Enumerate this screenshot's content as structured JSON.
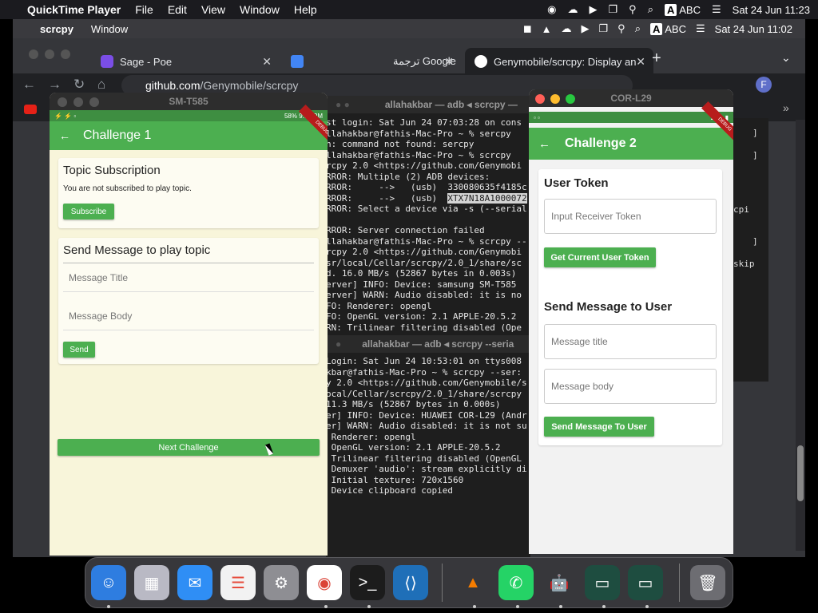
{
  "menubar": {
    "app": "QuickTime Player",
    "items": [
      "File",
      "Edit",
      "View",
      "Window",
      "Help"
    ],
    "input_source": "ABC",
    "datetime": "Sat 24 Jun  11:23"
  },
  "scrcpy_menubar": {
    "app": "scrcpy",
    "items": [
      "Window"
    ],
    "input_source": "ABC",
    "datetime": "Sat 24 Jun  11:02"
  },
  "browser": {
    "tabs": [
      {
        "label": "Sage - Poe"
      },
      {
        "label": "ترجمة Google"
      },
      {
        "label": "Genymobile/scrcpy: Display an"
      }
    ],
    "url_host": "github.com",
    "url_path": "/Genymobile/scrcpy",
    "profile_initial": "F"
  },
  "devices": {
    "left": {
      "window_title": "SM-T585",
      "status_right": "58% 9:02 PM",
      "debug_banner": "DEBUG",
      "app_title": "Challenge 1",
      "topic_card": {
        "title": "Topic Subscription",
        "text": "You are not subscribed to play topic.",
        "button": "Subscribe"
      },
      "send_card": {
        "title": "Send Message to play topic",
        "title_placeholder": "Message Title",
        "body_placeholder": "Message Body",
        "button": "Send"
      },
      "next_button": "Next Challenge"
    },
    "right": {
      "window_title": "COR-L29",
      "debug_banner": "DEBUG",
      "app_title": "Challenge 2",
      "token_title": "User Token",
      "token_placeholder": "Input Receiver Token",
      "token_button": "Get Current User Token",
      "send_title": "Send Message to User",
      "title_placeholder": "Message title",
      "body_placeholder": "Message body",
      "send_button": "Send Message To User"
    }
  },
  "terminal": {
    "window1_title": "allahakbar — adb ◂ scrcpy —",
    "window1_lines": [
      "st login: Sat Jun 24 07:03:28 on cons",
      "llahakbar@fathis-Mac-Pro ~ % sercpy",
      "h: command not found: sercpy",
      "llahakbar@fathis-Mac-Pro ~ % scrcpy",
      "rcpy 2.0 <https://github.com/Genymobi",
      "RROR: Multiple (2) ADB devices:",
      "RROR:     -->   (usb)  330080635f4185c",
      "RROR:     -->   (usb)  XTX7N18A1000072",
      "RROR: Select a device via -s (--serial",
      "",
      "RROR: Server connection failed",
      "llahakbar@fathis-Mac-Pro ~ % scrcpy --",
      "rcpy 2.0 <https://github.com/Genymobi",
      "sr/local/Cellar/scrcpy/2.0_1/share/sc",
      "d. 16.0 MB/s (52867 bytes in 0.003s)",
      "erver] INFO: Device: samsung SM-T585",
      "erver] WARN: Audio disabled: it is no",
      "FO: Renderer: opengl",
      "FO: OpenGL version: 2.1 APPLE-20.5.2",
      "RN: Trilinear filtering disabled (Ope"
    ],
    "window2_title": "allahakbar — adb ◂ scrcpy --seria",
    "window2_lines": [
      "Login: Sat Jun 24 10:53:01 on ttys008",
      "kbar@fathis-Mac-Pro ~ % scrcpy --ser:",
      "y 2.0 <https://github.com/Genymobile/s",
      "ocal/Cellar/scrcpy/2.0_1/share/scrcpy",
      "11.3 MB/s (52867 bytes in 0.000s)",
      "er] INFO: Device: HUAWEI COR-L29 (Andr",
      "er] WARN: Audio disabled: it is not su",
      " Renderer: opengl",
      " OpenGL version: 2.1 APPLE-20.5.2",
      " Trilinear filtering disabled (OpenGL",
      " Demuxer 'audio': stream explicitly di",
      " Initial texture: 720x1560",
      " Device clipboard copied"
    ],
    "right_fragments": [
      "]",
      "]",
      "cpi",
      "]",
      "skip"
    ]
  },
  "dock": {
    "icons": [
      "finder-icon",
      "launchpad-icon",
      "mail-icon",
      "reminders-icon",
      "system-settings-icon",
      "chrome-icon",
      "terminal-icon",
      "vscode-icon",
      "vlc-icon",
      "whatsapp-icon",
      "android-studio-icon",
      "scrcpy-icon",
      "scrcpy-icon",
      "trash-icon"
    ]
  },
  "colors": {
    "accent_green": "#4caf50",
    "card_bg": "#fdfcf2",
    "debug_red": "#b71c1c"
  }
}
